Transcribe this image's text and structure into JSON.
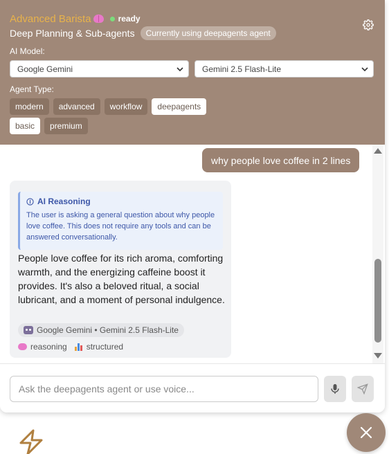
{
  "header": {
    "title": "Advanced Barista",
    "status": "ready",
    "subtitle": "Deep Planning & Sub-agents",
    "current_agent_badge": "Currently using deepagents agent",
    "ai_model_label": "AI Model:",
    "provider_select": "Google Gemini",
    "model_select": "Gemini 2.5 Flash-Lite",
    "agent_type_label": "Agent Type:",
    "agent_types": [
      "modern",
      "advanced",
      "workflow",
      "deepagents",
      "basic",
      "premium"
    ],
    "selected_agent_types": [
      "deepagents",
      "basic"
    ]
  },
  "chat": {
    "user_message": "why people love coffee in 2 lines",
    "reasoning_title": "AI Reasoning",
    "reasoning_body": "The user is asking a general question about why people love coffee. This does not require any tools and can be answered conversationally.",
    "bot_message": "People love coffee for its rich aroma, comforting warmth, and the energizing caffeine boost it provides. It's also a beloved ritual, a social lubricant, and a moment of personal indulgence.",
    "model_badge": "Google Gemini • Gemini 2.5 Flash-Lite",
    "tag_reasoning": "reasoning",
    "tag_structured": "structured"
  },
  "input": {
    "placeholder": "Ask the deepagents agent or use voice..."
  },
  "colors": {
    "header_bg": "#a08878",
    "title_accent": "#e8b24a",
    "status_green": "#7cdc7c",
    "user_bubble": "#9b8272",
    "reasoning_text": "#3d57a8"
  }
}
